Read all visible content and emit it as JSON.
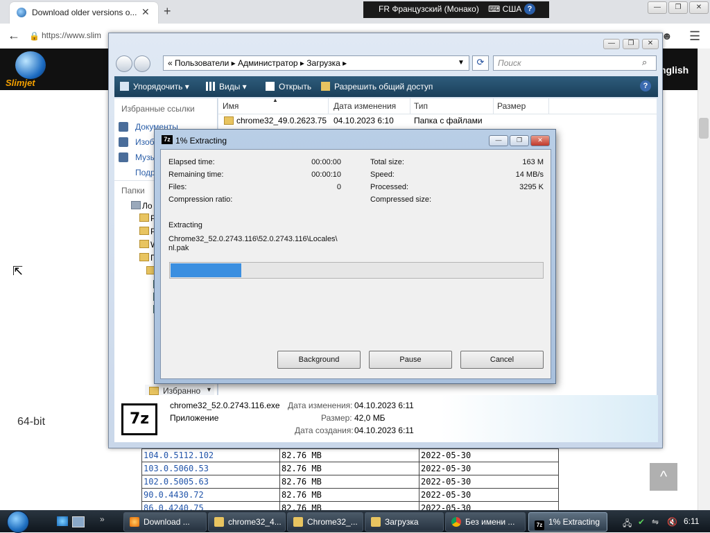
{
  "browser": {
    "tab_title": "Download older versions o...",
    "url": "https://www.slim",
    "new_tab": "+"
  },
  "language_bar": {
    "lang": "FR Французский (Монако)",
    "keyboard": "США",
    "help": "?"
  },
  "site": {
    "logo_name": "Slimjet",
    "english": "nglish",
    "label_64bit": "64-bit",
    "scroll_top": "^",
    "versions": [
      {
        "version": "104.0.5112.102",
        "size": "82.76 MB",
        "date": "2022-05-30"
      },
      {
        "version": "103.0.5060.53",
        "size": "82.76 MB",
        "date": "2022-05-30"
      },
      {
        "version": "102.0.5005.63",
        "size": "82.76 MB",
        "date": "2022-05-30"
      },
      {
        "version": "90.0.4430.72",
        "size": "82.76 MB",
        "date": "2022-05-30"
      },
      {
        "version": "86.0.4240.75",
        "size": "82.76 MB",
        "date": "2022-05-30"
      }
    ]
  },
  "explorer": {
    "breadcrumb": "«  Пользователи  ▸  Администратор  ▸  Загрузка  ▸",
    "search_placeholder": "Поиск",
    "commands": {
      "organize": "Упорядочить",
      "views": "Виды",
      "open": "Открыть",
      "share": "Разрешить общий доступ"
    },
    "sidebar": {
      "favorites_header": "Избранные ссылки",
      "links": [
        "Документы",
        "Изоб",
        "Музы",
        "Подр"
      ],
      "folders_header": "Папки",
      "tree": [
        "Ло",
        "Р",
        "Р",
        "W",
        "П"
      ]
    },
    "columns": {
      "name": "Имя",
      "date": "Дата изменения",
      "type": "Тип",
      "size": "Размер"
    },
    "row": {
      "name": "chrome32_49.0.2623.75",
      "date": "04.10.2023 6:10",
      "type": "Папка с файлами"
    },
    "favbar": "Избранно",
    "details": {
      "filename": "chrome32_52.0.2743.116.exe",
      "kind": "Приложение",
      "modified_label": "Дата изменения:",
      "modified": "04.10.2023 6:11",
      "size_label": "Размер:",
      "size": "42,0 МБ",
      "created_label": "Дата создания:",
      "created": "04.10.2023 6:11",
      "icon_text": "7z"
    }
  },
  "zip": {
    "title": "1% Extracting",
    "icon_text": "7z",
    "elapsed_label": "Elapsed time:",
    "elapsed": "00:00:00",
    "remaining_label": "Remaining time:",
    "remaining": "00:00:10",
    "files_label": "Files:",
    "files": "0",
    "ratio_label": "Compression ratio:",
    "total_label": "Total size:",
    "total": "163 M",
    "speed_label": "Speed:",
    "speed": "14 MB/s",
    "processed_label": "Processed:",
    "processed": "3295 K",
    "compressed_label": "Compressed size:",
    "status": "Extracting",
    "path_line1": "Chrome32_52.0.2743.116\\52.0.2743.116\\Locales\\",
    "path_line2": "nl.pak",
    "progress_fraction": 0.19,
    "buttons": {
      "background": "Background",
      "pause": "Pause",
      "cancel": "Cancel"
    }
  },
  "taskbar": {
    "tasks": [
      "Download ...",
      "chrome32_4...",
      "Chrome32_...",
      "Загрузка",
      "Без имени ...",
      "1% Extracting"
    ],
    "clock": "6:11"
  },
  "colors": {
    "progress": "#3b8fe0",
    "link": "#2255aa",
    "command_bar": "#1a3f5a"
  }
}
